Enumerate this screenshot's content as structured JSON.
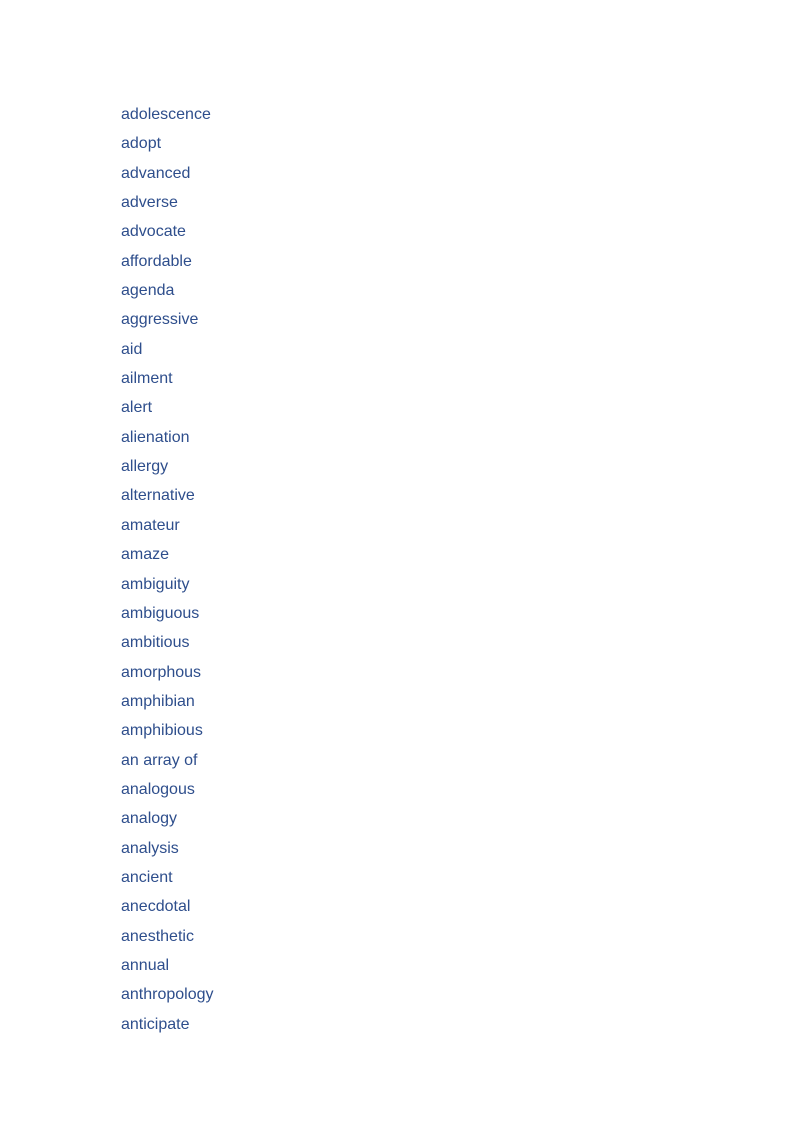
{
  "document": {
    "text_color": "#2e4e8c",
    "words": [
      "adolescence",
      "adopt",
      "advanced",
      "adverse",
      "advocate",
      "affordable",
      "agenda",
      "aggressive",
      "aid",
      "ailment",
      "alert",
      "alienation",
      "allergy",
      "alternative",
      "amateur",
      "amaze",
      "ambiguity",
      "ambiguous",
      "ambitious",
      "amorphous",
      "amphibian",
      "amphibious",
      "an array of",
      "analogous",
      "analogy",
      "analysis",
      "ancient",
      "anecdotal",
      "anesthetic",
      "annual",
      "anthropology",
      "anticipate"
    ]
  }
}
